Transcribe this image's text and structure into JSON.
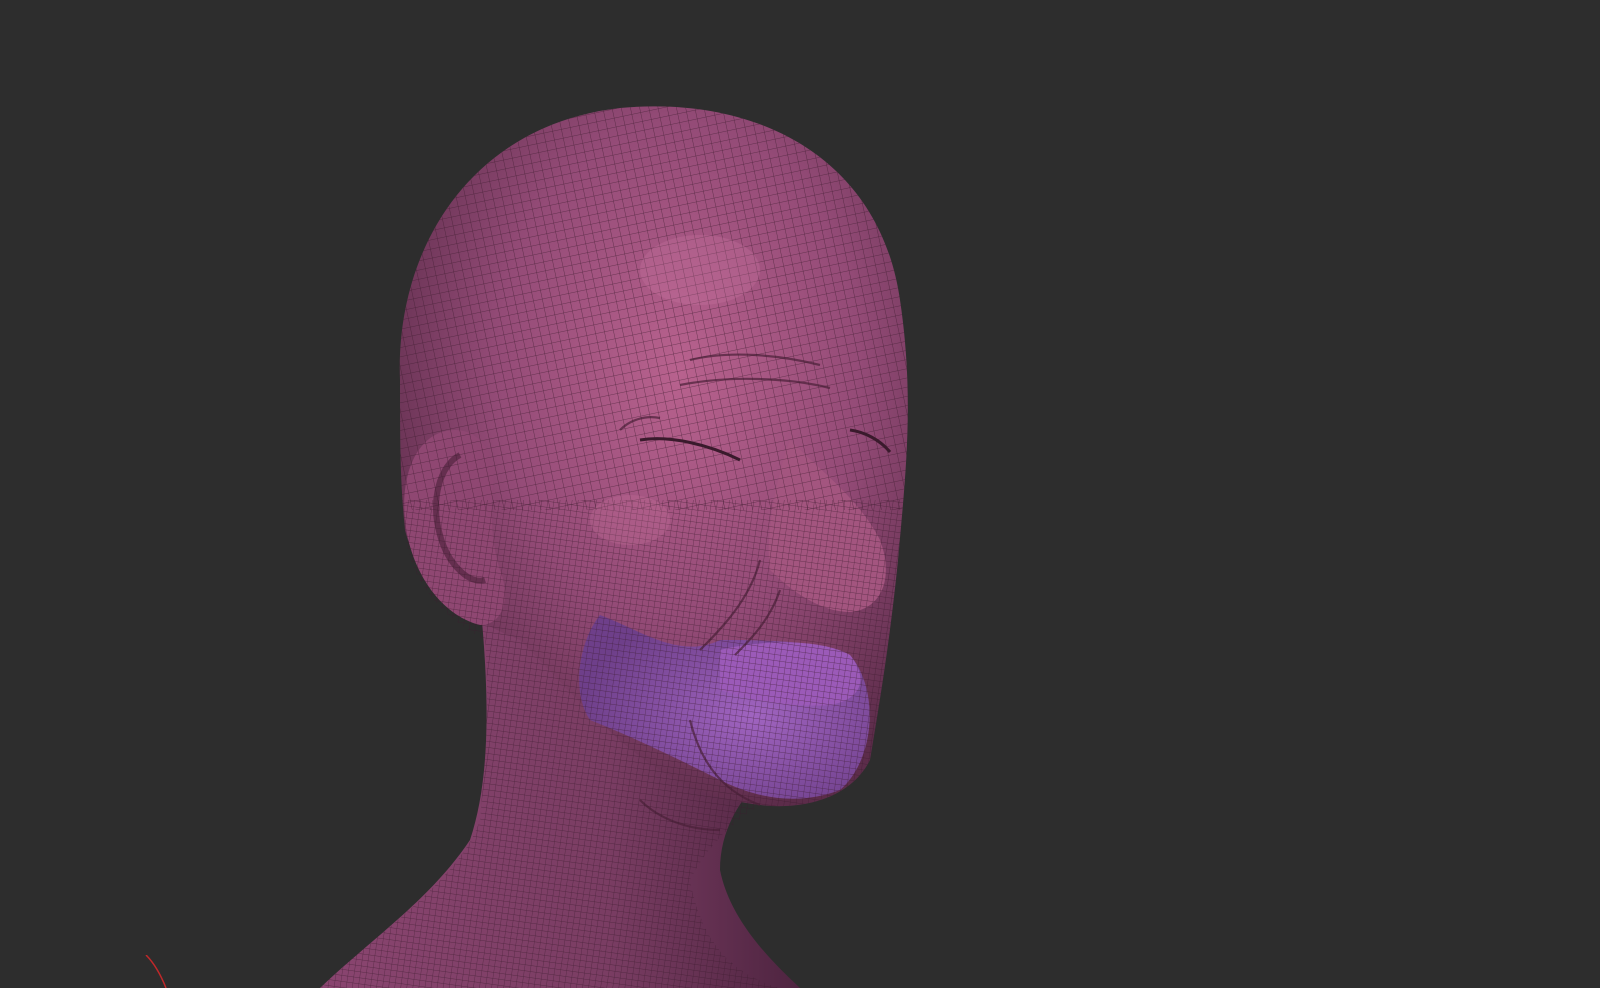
{
  "viewport": {
    "background_color": "#2d2d2d",
    "subject": "sculpted-head-wireframe",
    "mesh_color": "#9a4e7c",
    "mask_color": "#8a4fa0",
    "wire_color": "#3a1a2c",
    "axis_color": "#c0282a"
  }
}
